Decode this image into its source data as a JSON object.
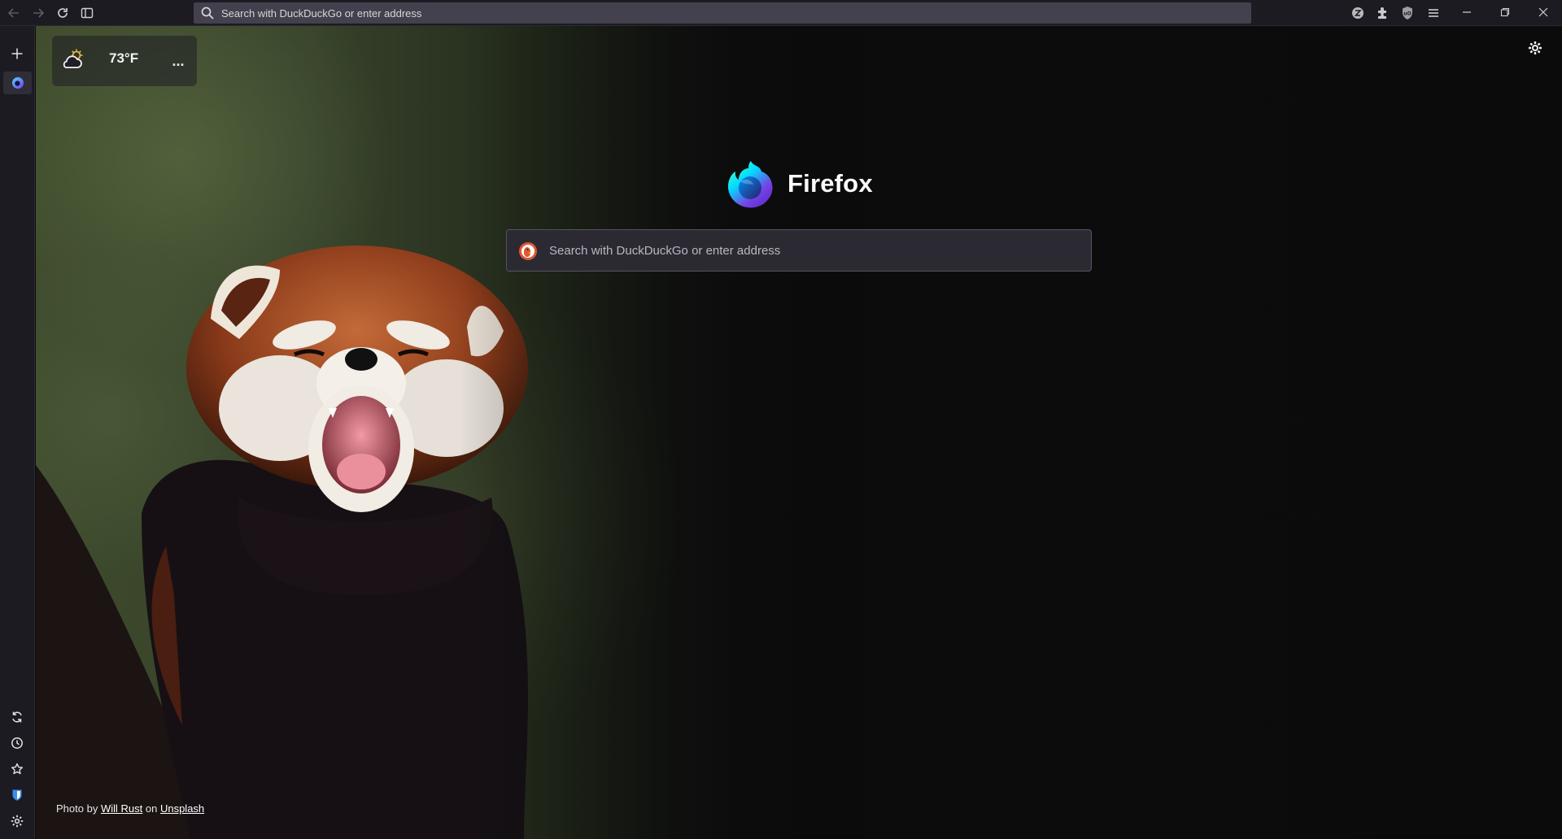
{
  "toolbar": {
    "back_icon": "arrow-left-icon",
    "forward_icon": "arrow-right-icon",
    "reload_icon": "reload-icon",
    "sidebar_toggle_icon": "sidebar-icon",
    "url_placeholder": "Search with DuckDuckGo or enter address",
    "extensions": [
      "zotero-icon",
      "puzzle-icon",
      "ublock-shield-icon",
      "menu-icon"
    ],
    "window_controls": [
      "minimize-icon",
      "restore-icon",
      "close-icon"
    ]
  },
  "sidebar": {
    "top_items": [
      "plus-icon",
      "firefox-tab-icon"
    ],
    "bottom_items": [
      "sync-icon",
      "history-icon",
      "bookmarks-star-icon",
      "bitwarden-icon",
      "settings-gear-icon"
    ]
  },
  "newtab": {
    "weather": {
      "temperature": "73°F",
      "more_label": "...",
      "icon": "partly-cloudy-icon"
    },
    "brand": {
      "name": "Firefox",
      "logo_icon": "firefox-logo-icon"
    },
    "search": {
      "placeholder": "Search with DuckDuckGo or enter address",
      "engine_icon": "duckduckgo-icon"
    },
    "credit": {
      "prefix": "Photo by",
      "author": "Will Rust",
      "middle": "on",
      "source": "Unsplash"
    },
    "settings_icon": "gear-icon"
  },
  "colors": {
    "toolbar_bg": "#1c1b22",
    "urlbar_bg": "#42414d",
    "search_bg": "#2b2a33",
    "page_bg": "#0b0b0c"
  }
}
